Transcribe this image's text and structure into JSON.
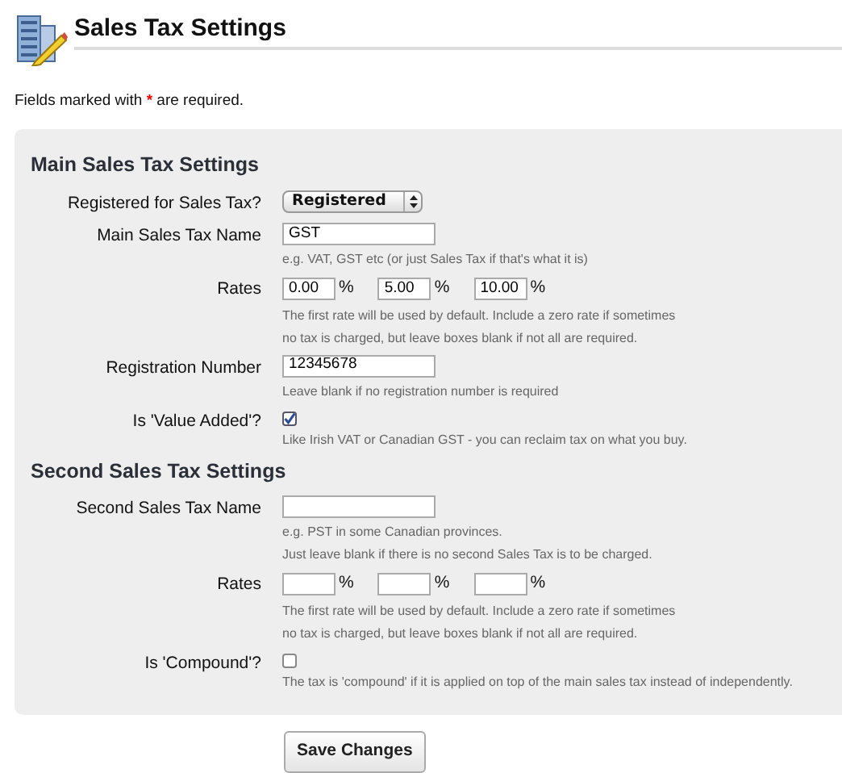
{
  "page_title": "Sales Tax Settings",
  "required_note": {
    "before": "Fields marked with",
    "mark": "*",
    "after": "are required."
  },
  "sections": [
    {
      "heading": "Main Sales Tax Settings",
      "rows": [
        {
          "kind": "select",
          "label": "Registered for Sales Tax?",
          "value": "Registered"
        },
        {
          "kind": "text",
          "label": "Main Sales Tax Name",
          "value": "GST",
          "help": [
            "e.g. VAT, GST etc (or just Sales Tax if that's what it is)"
          ]
        },
        {
          "kind": "rates",
          "label": "Rates",
          "rates": [
            {
              "value": "0.00",
              "unit": "%"
            },
            {
              "value": "5.00",
              "unit": "%"
            },
            {
              "value": "10.00",
              "unit": "%"
            }
          ],
          "help": [
            "The first rate will be used by default. Include a zero rate if sometimes",
            "no tax is charged, but leave boxes blank if not all are required."
          ]
        },
        {
          "kind": "text",
          "label": "Registration Number",
          "value": "12345678",
          "help": [
            "Leave blank if no registration number is required"
          ]
        },
        {
          "kind": "checkbox",
          "label": "Is 'Value Added'?",
          "checked": true,
          "help": [
            "Like Irish VAT or Canadian GST - you can reclaim tax on what you buy."
          ]
        }
      ]
    },
    {
      "heading": "Second Sales Tax Settings",
      "rows": [
        {
          "kind": "text",
          "label": "Second Sales Tax Name",
          "help": [
            "e.g. PST in some Canadian provinces.",
            "Just leave blank if there is no second Sales Tax is to be charged."
          ]
        },
        {
          "kind": "rates",
          "label": "Rates",
          "rates": [
            {
              "unit": "%"
            },
            {
              "unit": "%"
            },
            {
              "unit": "%"
            }
          ],
          "help": [
            "The first rate will be used by default. Include a zero rate if sometimes",
            "no tax is charged, but leave boxes blank if not all are required."
          ]
        },
        {
          "kind": "checkbox",
          "label": "Is 'Compound'?",
          "checked": false,
          "help": [
            "The tax is 'compound' if it is applied on top of the main sales tax instead of independently."
          ]
        }
      ]
    }
  ],
  "save_button": "Save Changes"
}
